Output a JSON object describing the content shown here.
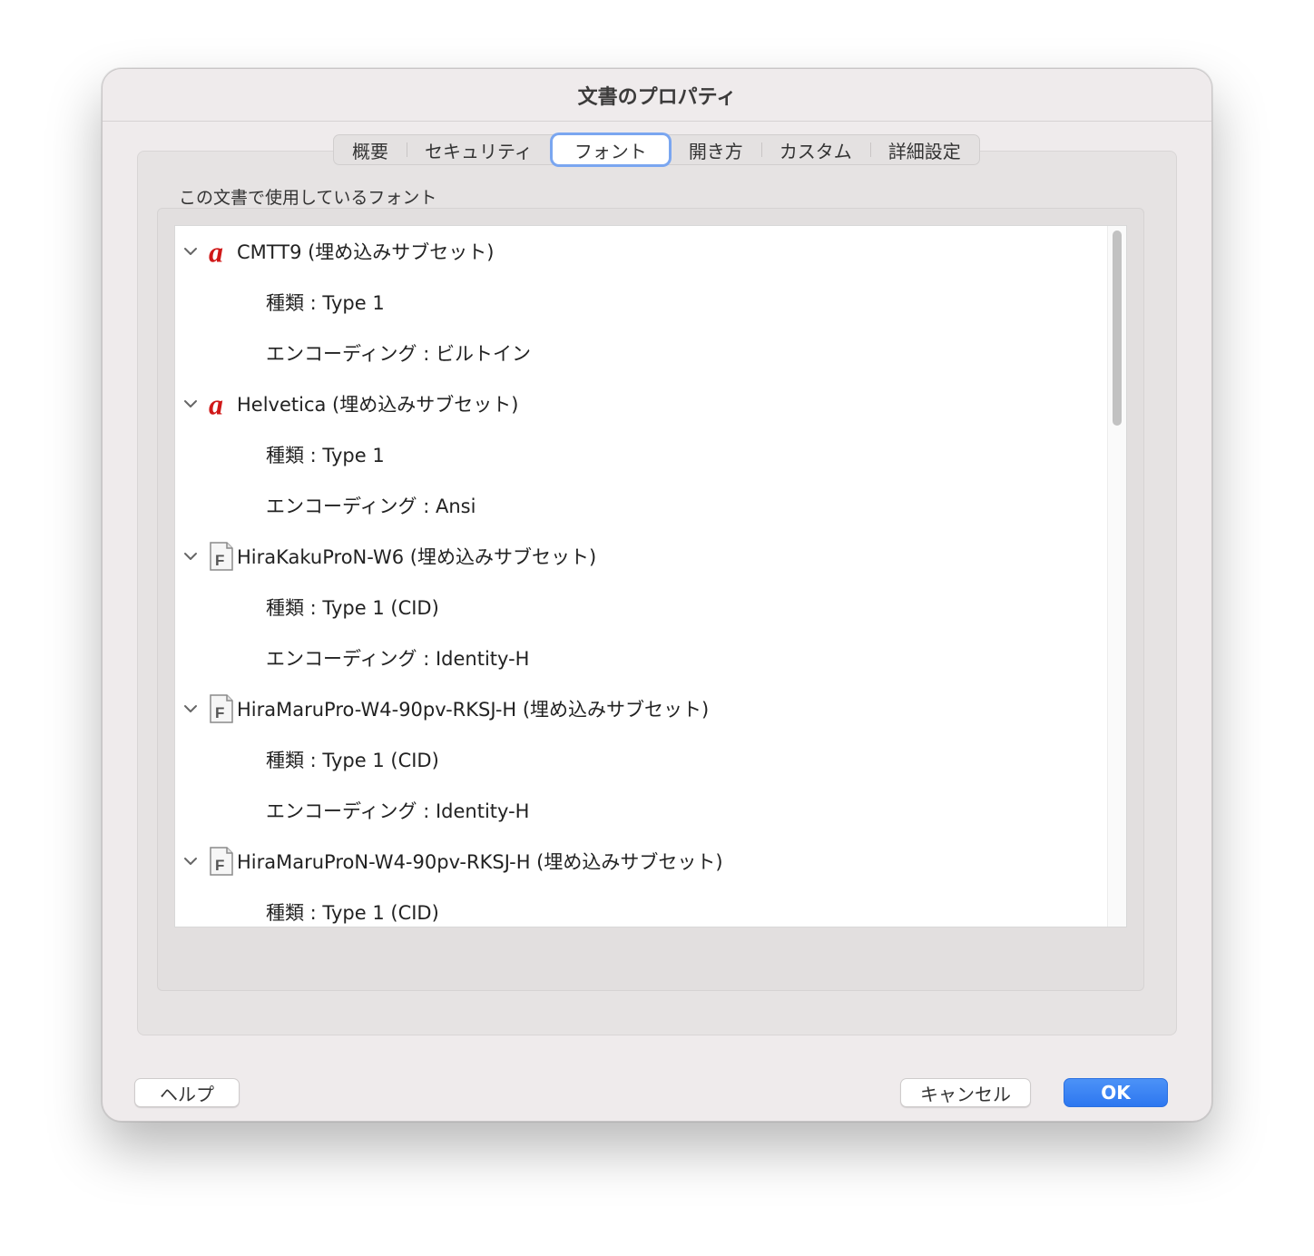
{
  "window": {
    "title": "文書のプロパティ"
  },
  "tabs": [
    {
      "label": "概要"
    },
    {
      "label": "セキュリティ"
    },
    {
      "label": "フォント",
      "selected": true
    },
    {
      "label": "開き方"
    },
    {
      "label": "カスタム"
    },
    {
      "label": "詳細設定"
    }
  ],
  "fonts_section": {
    "label": "この文書で使用しているフォント",
    "fonts": [
      {
        "name": "CMTT9 (埋め込みサブセット)",
        "icon": "type1-font-icon",
        "type": "種類 : Type 1",
        "encoding": "エンコーディング : ビルトイン"
      },
      {
        "name": "Helvetica (埋め込みサブセット)",
        "icon": "type1-font-icon",
        "type": "種類 : Type 1",
        "encoding": "エンコーディング : Ansi"
      },
      {
        "name": "HiraKakuProN-W6 (埋め込みサブセット)",
        "icon": "cid-font-icon",
        "type": "種類 : Type 1 (CID)",
        "encoding": "エンコーディング : Identity-H"
      },
      {
        "name": "HiraMaruPro-W4-90pv-RKSJ-H (埋め込みサブセット)",
        "icon": "cid-font-icon",
        "type": "種類 : Type 1 (CID)",
        "encoding": "エンコーディング : Identity-H"
      },
      {
        "name": "HiraMaruProN-W4-90pv-RKSJ-H (埋め込みサブセット)",
        "icon": "cid-font-icon",
        "type": "種類 : Type 1 (CID)",
        "encoding": ""
      }
    ]
  },
  "buttons": {
    "help": "ヘルプ",
    "cancel": "キャンセル",
    "ok": "OK"
  },
  "colors": {
    "accent": "#2d77f0",
    "type1_icon": "#d01818",
    "window_bg": "#efebec"
  }
}
